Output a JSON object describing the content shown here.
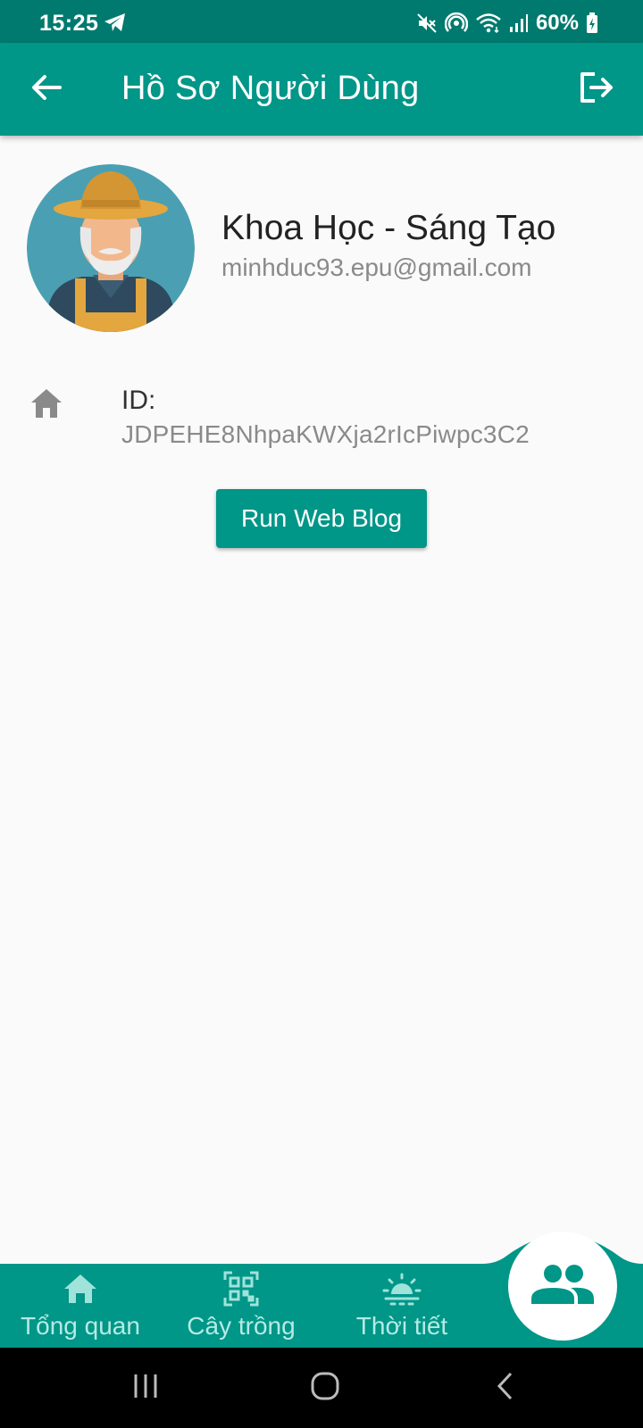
{
  "status_bar": {
    "time": "15:25",
    "battery": "60%",
    "icons": [
      "telegram-icon",
      "mute-icon",
      "hotspot-icon",
      "wifi-icon",
      "signal-icon",
      "battery-icon"
    ]
  },
  "app_bar": {
    "title": "Hồ Sơ Người Dùng",
    "back_icon": "arrow-left-icon",
    "logout_icon": "logout-icon"
  },
  "profile": {
    "name": "Khoa Học - Sáng Tạo",
    "email": "minhduc93.epu@gmail.com",
    "id_label": "ID:",
    "id_value": "JDPEHE8NhpaKWXja2rIcPiwpc3C2"
  },
  "actions": {
    "run_web_blog": "Run Web Blog"
  },
  "bottom_nav": {
    "items": [
      {
        "label": "Tổng quan",
        "icon": "home-icon"
      },
      {
        "label": "Cây trồng",
        "icon": "qr-code-icon"
      },
      {
        "label": "Thời tiết",
        "icon": "weather-icon"
      }
    ],
    "fab_icon": "people-icon"
  },
  "colors": {
    "primary": "#009688",
    "status_bar": "#007a6e",
    "background": "#fafafa"
  }
}
